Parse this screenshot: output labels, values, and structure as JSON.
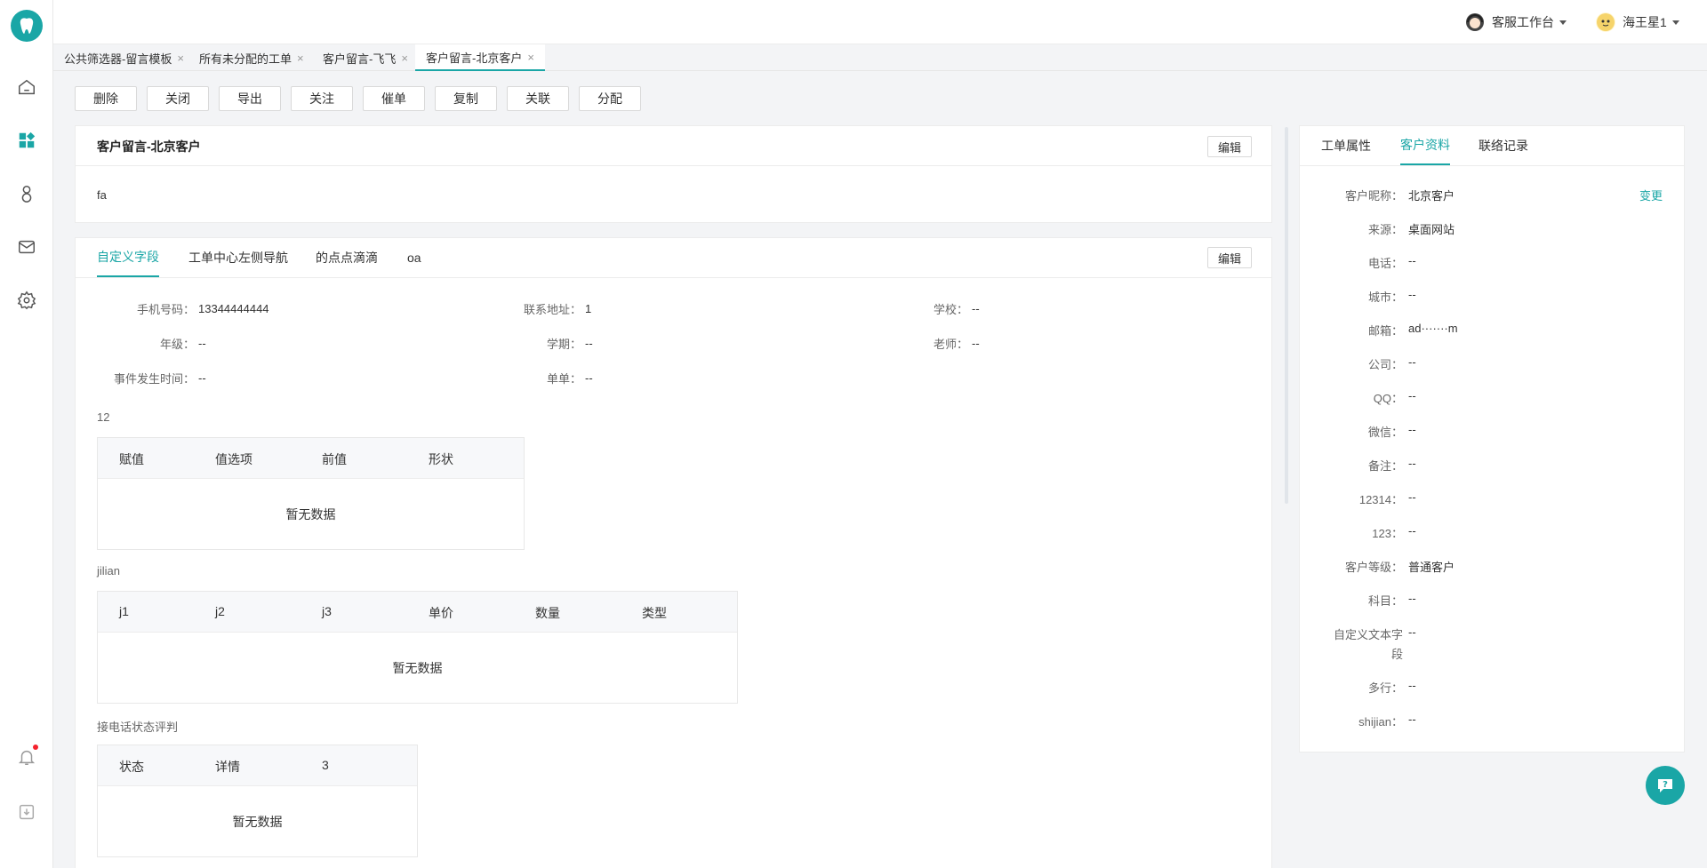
{
  "header": {
    "workspace_label": "客服工作台",
    "user_name": "海王星1"
  },
  "rail": {
    "items": [
      "home-icon",
      "dashboard-icon",
      "contacts-icon",
      "mail-icon",
      "settings-icon"
    ],
    "bottom": [
      "bell-icon",
      "download-icon"
    ]
  },
  "tabs": [
    {
      "label": "公共筛选器-留言模板"
    },
    {
      "label": "所有未分配的工单"
    },
    {
      "label": "客户留言-飞飞"
    },
    {
      "label": "客户留言-北京客户"
    }
  ],
  "actions": [
    "删除",
    "关闭",
    "导出",
    "关注",
    "催单",
    "复制",
    "关联",
    "分配"
  ],
  "ticket": {
    "title": "客户留言-北京客户",
    "edit_label": "编辑",
    "body": "fa"
  },
  "fields_panel": {
    "tabs": [
      "自定义字段",
      "工单中心左侧导航",
      "的点点滴滴",
      "oa"
    ],
    "edit_label": "编辑",
    "fields": [
      {
        "label": "手机号码：",
        "value": "13344444444"
      },
      {
        "label": "联系地址：",
        "value": "1"
      },
      {
        "label": "学校：",
        "value": "--"
      },
      {
        "label": "年级：",
        "value": "--"
      },
      {
        "label": "学期：",
        "value": "--"
      },
      {
        "label": "老师：",
        "value": "--"
      },
      {
        "label": "事件发生时间：",
        "value": "--"
      },
      {
        "label": "单单：",
        "value": "--"
      }
    ],
    "tables": [
      {
        "name": "12",
        "columns": [
          "赋值",
          "值选项",
          "前值",
          "形状"
        ],
        "empty": "暂无数据"
      },
      {
        "name": "jilian",
        "columns": [
          "j1",
          "j2",
          "j3",
          "单价",
          "数量",
          "类型"
        ],
        "empty": "暂无数据"
      },
      {
        "name": "接电话状态评判",
        "columns": [
          "状态",
          "详情",
          "3"
        ],
        "empty": "暂无数据"
      }
    ]
  },
  "customer_panel": {
    "tabs": [
      "工单属性",
      "客户资料",
      "联络记录"
    ],
    "change_label": "变更",
    "rows": [
      {
        "label": "客户昵称：",
        "value": "北京客户"
      },
      {
        "label": "来源：",
        "value": "桌面网站"
      },
      {
        "label": "电话：",
        "value": "--"
      },
      {
        "label": "城市：",
        "value": "--"
      },
      {
        "label": "邮箱：",
        "value": "ad·······m"
      },
      {
        "label": "公司：",
        "value": "--"
      },
      {
        "label": "QQ：",
        "value": "--"
      },
      {
        "label": "微信：",
        "value": "--"
      },
      {
        "label": "备注：",
        "value": "--"
      },
      {
        "label": "12314：",
        "value": "--"
      },
      {
        "label": "123：",
        "value": "--"
      },
      {
        "label": "客户等级：",
        "value": "普通客户"
      },
      {
        "label": "科目：",
        "value": "--"
      },
      {
        "label": "自定义文本字",
        "label2": "段",
        "value": "--"
      },
      {
        "label": "多行：",
        "value": "--"
      },
      {
        "label": "shijian：",
        "value": "--"
      }
    ]
  },
  "colors": {
    "accent": "#1aa6a6",
    "notification": "#f5222d"
  }
}
